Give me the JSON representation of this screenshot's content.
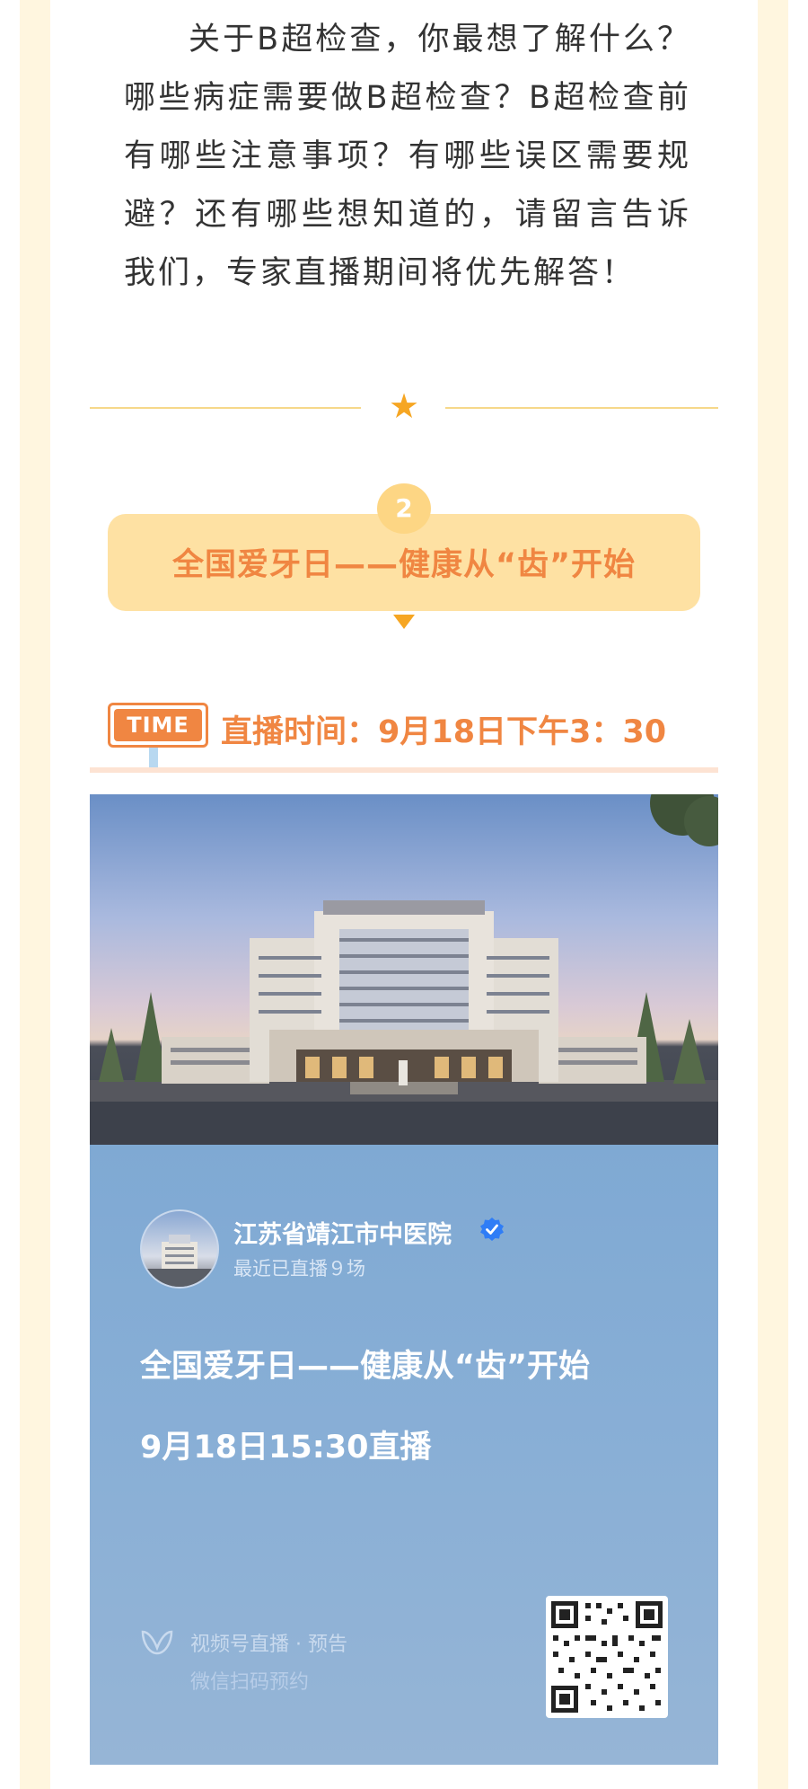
{
  "article": {
    "intro": "关于B超检查，你最想了解什么？哪些病症需要做B超检查？B超检查前有哪些注意事项？有哪些误区需要规避？还有哪些想知道的，请留言告诉我们，专家直播期间将优先解答！"
  },
  "divider": {
    "icon": "star-icon",
    "color": "#f6a623"
  },
  "section": {
    "number": "2",
    "title": "全国爱牙日——健康从“齿”开始"
  },
  "live_time": {
    "badge": "TIME",
    "text": "直播时间：9月18日下午3：30"
  },
  "poster": {
    "account_name": "江苏省靖江市中医院",
    "verified_icon": "verified-badge-icon",
    "live_count": "最近已直播９场",
    "title": "全国爱牙日——健康从“齿”开始",
    "schedule": "9月18日15:30直播",
    "channel_label": "视频号直播 · 预告",
    "channel_hint": "微信扫码预约",
    "qr_icon": "qr-code-icon"
  },
  "colors": {
    "accent_orange": "#f08642",
    "banner_yellow": "#fee1a3",
    "poster_blue": "#86aed6",
    "page_cream": "#fff8e6"
  }
}
